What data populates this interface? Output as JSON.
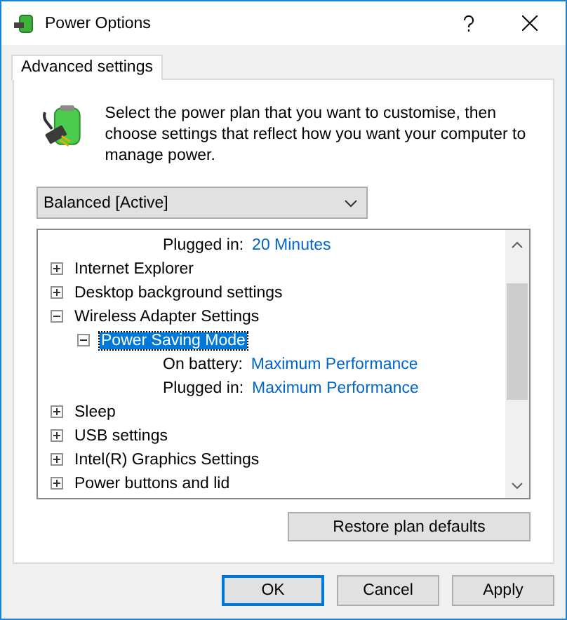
{
  "window": {
    "title": "Power Options"
  },
  "tabs": [
    {
      "label": "Advanced settings",
      "selected": true
    }
  ],
  "description": "Select the power plan that you want to customise, then choose settings that reflect how you want your computer to manage power.",
  "plan_dropdown": {
    "value": "Balanced [Active]"
  },
  "tree": [
    {
      "kind": "setting",
      "label": "Plugged in:",
      "value": "20 Minutes"
    },
    {
      "kind": "group",
      "label": "Internet Explorer",
      "expanded": false,
      "selected": false
    },
    {
      "kind": "group",
      "label": "Desktop background settings",
      "expanded": false,
      "selected": false
    },
    {
      "kind": "group",
      "label": "Wireless Adapter Settings",
      "expanded": true,
      "selected": false,
      "children": [
        {
          "kind": "group",
          "label": "Power Saving Mode",
          "expanded": true,
          "selected": true,
          "children": [
            {
              "kind": "setting",
              "label": "On battery:",
              "value": "Maximum Performance"
            },
            {
              "kind": "setting",
              "label": "Plugged in:",
              "value": "Maximum Performance"
            }
          ]
        }
      ]
    },
    {
      "kind": "group",
      "label": "Sleep",
      "expanded": false,
      "selected": false
    },
    {
      "kind": "group",
      "label": "USB settings",
      "expanded": false,
      "selected": false
    },
    {
      "kind": "group",
      "label": "Intel(R) Graphics Settings",
      "expanded": false,
      "selected": false
    },
    {
      "kind": "group",
      "label": "Power buttons and lid",
      "expanded": false,
      "selected": false
    }
  ],
  "restore_button": "Restore plan defaults",
  "buttons": [
    {
      "label": "OK",
      "default": true
    },
    {
      "label": "Cancel",
      "default": false
    },
    {
      "label": "Apply",
      "default": false
    }
  ]
}
